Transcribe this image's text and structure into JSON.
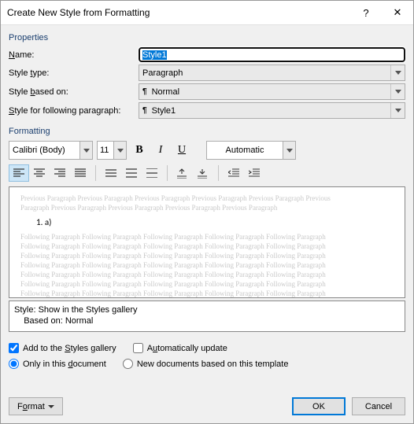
{
  "title": "Create New Style from Formatting",
  "sections": {
    "properties": "Properties",
    "formatting": "Formatting"
  },
  "labels": {
    "name": "Name:",
    "styleType": "Style type:",
    "basedOn": "Style based on:",
    "following": "Style for following paragraph:"
  },
  "fields": {
    "name": "Style1",
    "styleType": "Paragraph",
    "basedOn": "Normal",
    "following": "Style1"
  },
  "format": {
    "font": "Calibri (Body)",
    "size": "11",
    "color": "Automatic"
  },
  "preview": {
    "prev1": "Previous Paragraph Previous Paragraph Previous Paragraph Previous Paragraph Previous Paragraph Previous",
    "prev2": "Paragraph Previous Paragraph Previous Paragraph Previous Paragraph Previous Paragraph",
    "sample": "1.            a)",
    "foll": "Following Paragraph Following Paragraph Following Paragraph Following Paragraph Following Paragraph"
  },
  "description": {
    "l1": "Style: Show in the Styles gallery",
    "l2": "    Based on: Normal"
  },
  "checks": {
    "addGallery": "Add to the Styles gallery",
    "autoUpdate": "Automatically update",
    "onlyDoc": "Only in this document",
    "newDocs": "New documents based on this template"
  },
  "buttons": {
    "format": "Format",
    "ok": "OK",
    "cancel": "Cancel"
  }
}
